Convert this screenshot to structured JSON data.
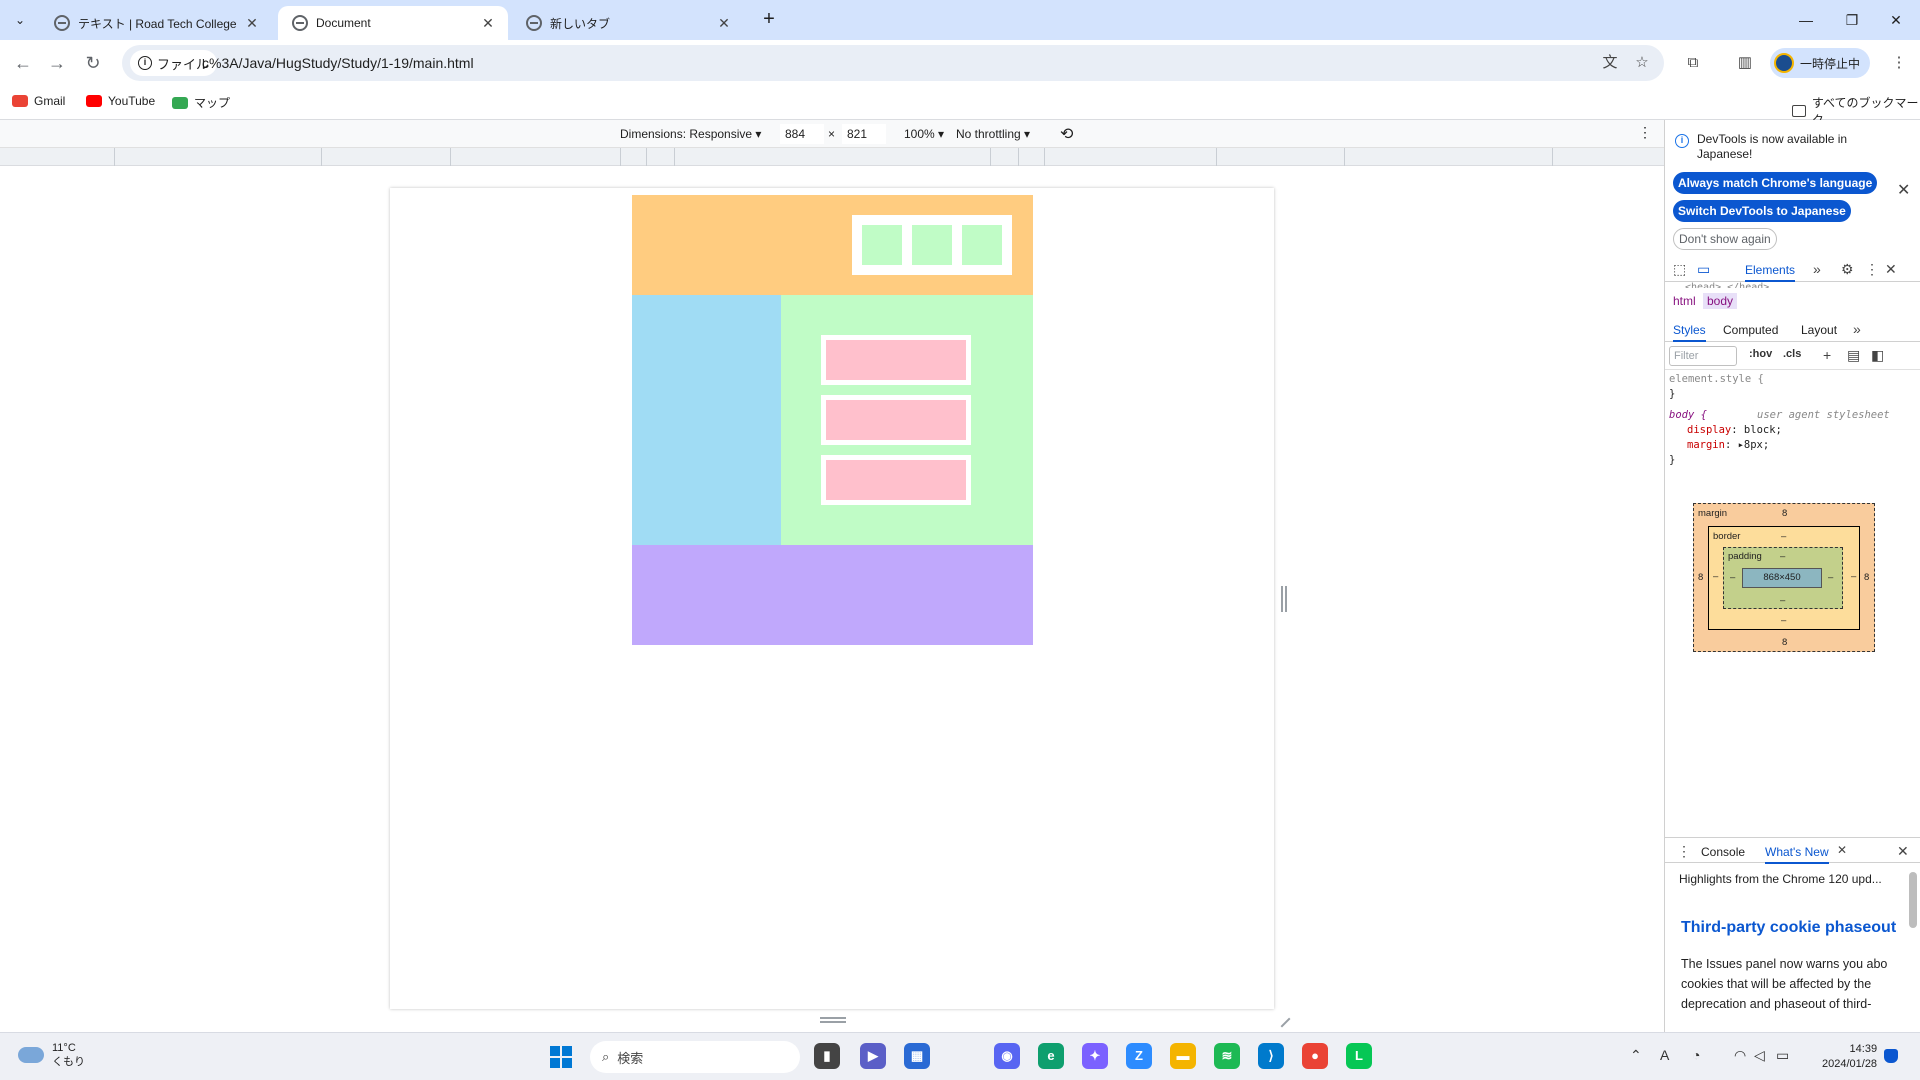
{
  "tabs": [
    {
      "title": "テキスト | Road Tech College"
    },
    {
      "title": "Document"
    },
    {
      "title": "新しいタブ"
    }
  ],
  "toolbar": {
    "scheme_chip": "ファイル",
    "url": "c%3A/Java/HugStudy/Study/1-19/main.html",
    "profile_label": "一時停止中"
  },
  "bookmarks": {
    "items": [
      {
        "label": "Gmail",
        "color": "#ea4335"
      },
      {
        "label": "YouTube",
        "color": "#ff0000"
      },
      {
        "label": "マップ",
        "color": "#34a853"
      }
    ],
    "all_bookmarks": "すべてのブックマーク"
  },
  "device_toolbar": {
    "dimensions": "Dimensions: Responsive",
    "width": "884",
    "times": "×",
    "height": "821",
    "zoom": "100%",
    "throttling": "No throttling"
  },
  "rendered_page": {
    "colors": {
      "header": "#ffcc80",
      "nav_item": "#c0fcc6",
      "side": "#a0dcf4",
      "main": "#c0fcc6",
      "card": "#ffc0cc",
      "footer": "#c0a8fc"
    }
  },
  "devtools": {
    "infobar": {
      "message": "DevTools is now available in Japanese!",
      "btn_match": "Always match Chrome's language",
      "btn_switch": "Switch DevTools to Japanese",
      "btn_dismiss": "Don't show again"
    },
    "tabs": {
      "elements": "Elements"
    },
    "head_snippet": "<head>…</head>",
    "crumbs": [
      "html",
      "body"
    ],
    "subtabs": {
      "styles": "Styles",
      "computed": "Computed",
      "layout": "Layout"
    },
    "filter": {
      "placeholder": "Filter",
      "hov": ":hov",
      "cls": ".cls"
    },
    "styles": {
      "element_style": "element.style {",
      "close_brace": "}",
      "body_selector": "body {",
      "ua_label": "user agent stylesheet",
      "display_prop": "display",
      "display_val": "block;",
      "margin_prop": "margin",
      "margin_val": "8px;"
    },
    "box_model": {
      "margin_label": "margin",
      "margin_value": "8",
      "border_label": "border",
      "padding_label": "padding",
      "dash": "–",
      "content_size": "868×450"
    },
    "drawer": {
      "console": "Console",
      "whats_new": "What's New",
      "highlights": "Highlights from the Chrome 120 upd...",
      "article_title": "Third-party cookie phaseout",
      "article_lines": [
        "The Issues panel now warns you abo",
        "cookies that will be affected by the",
        "deprecation and phaseout of third-"
      ]
    }
  },
  "taskbar": {
    "temperature": "11°C",
    "condition": "くもり",
    "search_placeholder": "検索",
    "time": "14:39",
    "date": "2024/01/28"
  }
}
